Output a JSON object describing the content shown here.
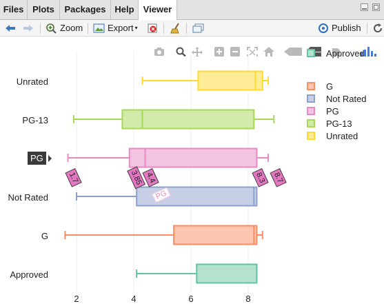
{
  "tabs": [
    {
      "label": "Files",
      "active": false
    },
    {
      "label": "Plots",
      "active": false
    },
    {
      "label": "Packages",
      "active": false
    },
    {
      "label": "Help",
      "active": false
    },
    {
      "label": "Viewer",
      "active": true
    }
  ],
  "toolbar": {
    "zoom_label": "Zoom",
    "export_label": "Export",
    "publish_label": "Publish"
  },
  "modebar_icons": [
    "camera-icon",
    "zoom-icon",
    "pan-icon",
    "zoom-in-icon",
    "zoom-out-icon",
    "autoscale-icon",
    "home-icon",
    "spike-lines-icon",
    "compare-icon",
    "toggle-hover-icon",
    "plotly-logo-icon"
  ],
  "hover": {
    "yaxis_label": "PG",
    "labels": [
      "1.7",
      "3.85",
      "4.4",
      "8.3",
      "8.7"
    ],
    "trace_label": "PG"
  },
  "chart_data": {
    "type": "box",
    "orientation": "horizontal",
    "categories": [
      "Approved",
      "G",
      "Not Rated",
      "PG",
      "PG-13",
      "Unrated"
    ],
    "x_ticks": [
      "2",
      "4",
      "6",
      "8"
    ],
    "xlim": [
      1.2,
      9.2
    ],
    "legend_placement": "top-right",
    "series": [
      {
        "name": "Approved",
        "color": "#66c2a5",
        "fill": "#b3e2cd",
        "min": 4.1,
        "q1": 6.2,
        "median": 8.3,
        "q3": 8.3,
        "max": 8.3
      },
      {
        "name": "G",
        "color": "#fc8d62",
        "fill": "#fdc6b0",
        "min": 1.6,
        "q1": 5.4,
        "median": 8.2,
        "q3": 8.3,
        "max": 8.5
      },
      {
        "name": "Not Rated",
        "color": "#8da0cb",
        "fill": "#c6cfe5",
        "min": 2.0,
        "q1": 4.1,
        "median": 8.2,
        "q3": 8.3,
        "max": 8.3
      },
      {
        "name": "PG",
        "color": "#e78ac3",
        "fill": "#f3c4e1",
        "min": 1.7,
        "q1": 3.85,
        "median": 4.4,
        "q3": 8.3,
        "max": 8.7
      },
      {
        "name": "PG-13",
        "color": "#a6d854",
        "fill": "#d2ebaa",
        "min": 1.9,
        "q1": 3.6,
        "median": 4.3,
        "q3": 8.2,
        "max": 8.9
      },
      {
        "name": "Unrated",
        "color": "#ffd92f",
        "fill": "#ffec97",
        "min": 4.3,
        "q1": 6.25,
        "median": 8.25,
        "q3": 8.5,
        "max": 8.7
      }
    ]
  }
}
